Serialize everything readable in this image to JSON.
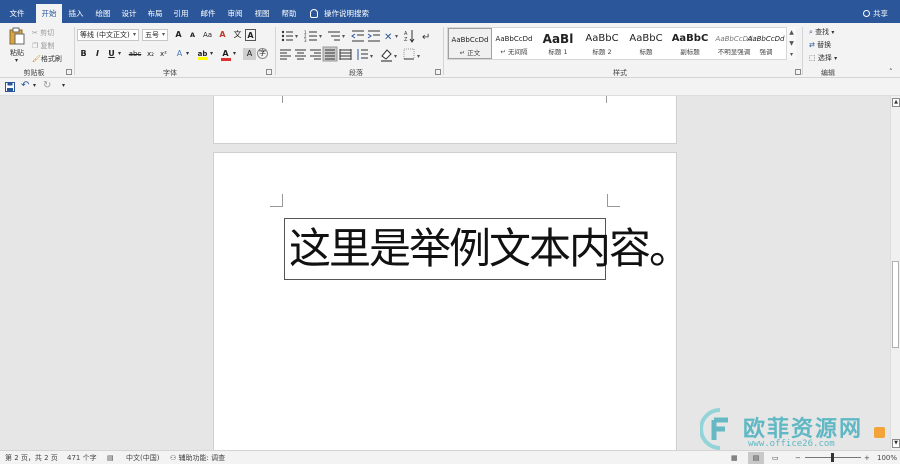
{
  "tabs": [
    {
      "label": "文件",
      "active": false
    },
    {
      "label": "开始",
      "active": true
    },
    {
      "label": "插入",
      "active": false
    },
    {
      "label": "绘图",
      "active": false
    },
    {
      "label": "设计",
      "active": false
    },
    {
      "label": "布局",
      "active": false
    },
    {
      "label": "引用",
      "active": false
    },
    {
      "label": "邮件",
      "active": false
    },
    {
      "label": "审阅",
      "active": false
    },
    {
      "label": "视图",
      "active": false
    },
    {
      "label": "帮助",
      "active": false
    }
  ],
  "tell_me": "操作说明搜索",
  "share": "共享",
  "clipboard": {
    "paste": "粘贴",
    "cut": "剪切",
    "copy": "复制",
    "format_painter": "格式刷",
    "label": "剪贴板"
  },
  "font": {
    "font_name": "等线 (中文正文)",
    "font_size": "五号",
    "bold": "B",
    "italic": "I",
    "underline": "U",
    "strike": "abc",
    "subscript": "x₂",
    "superscript": "x²",
    "grow": "A",
    "shrink": "A",
    "change_case": "Aa",
    "char_border": "A",
    "text_effect": "A",
    "font_color": "A",
    "char_shading": "A",
    "wen": "文",
    "label": "字体"
  },
  "paragraph": {
    "label": "段落"
  },
  "styles": {
    "label": "样式",
    "items": [
      {
        "preview": "AaBbCcDd",
        "name": "↵ 正文",
        "selected": true
      },
      {
        "preview": "AaBbCcDd",
        "name": "↵ 无间隔",
        "selected": false
      },
      {
        "preview": "AaBl",
        "name": "标题 1",
        "selected": false
      },
      {
        "preview": "AaBbC",
        "name": "标题 2",
        "selected": false
      },
      {
        "preview": "AaBbC",
        "name": "标题",
        "selected": false
      },
      {
        "preview": "AaBbC",
        "name": "副标题",
        "selected": false
      },
      {
        "preview": "AaBbCcDd",
        "name": "不明显强调",
        "selected": false
      },
      {
        "preview": "AaBbCcDd",
        "name": "强调",
        "selected": false
      }
    ]
  },
  "editing": {
    "find": "查找",
    "replace": "替换",
    "select": "选择",
    "label": "编辑"
  },
  "document": {
    "textbox_text": "这里是举例文本内容。"
  },
  "watermark": {
    "brand": "欧菲资源网",
    "url": "www.office26.com"
  },
  "status": {
    "page": "第 2 页，共 2 页",
    "words": "471 个字",
    "language": "中文(中国)",
    "accessibility": "辅助功能: 调查",
    "zoom": "100%"
  },
  "colors": {
    "accent": "#2b579a",
    "ribbon_bg": "#f3f3f3",
    "watermark": "#5fb8c4"
  }
}
